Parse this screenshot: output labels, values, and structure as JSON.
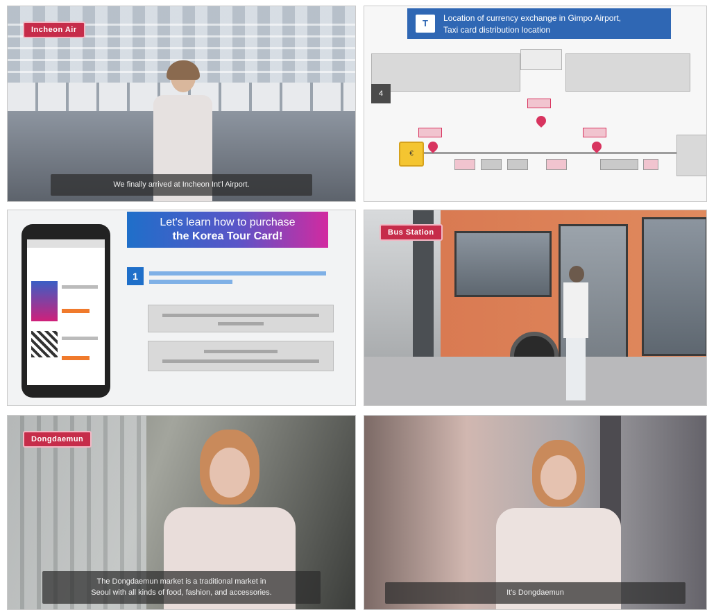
{
  "panels": {
    "p1": {
      "badge": "Incheon Air",
      "subtitle": "We finally arrived at Incheon Int'l Airport."
    },
    "p2": {
      "title_line1": "Location of currency exchange in Gimpo Airport,",
      "title_line2": "Taxi card distribution location",
      "icon": "T",
      "gate": "4",
      "kiosk": "€"
    },
    "p3": {
      "promo_line1": "Let's learn how to purchase",
      "promo_line2": "the Korea Tour Card!",
      "step": "1"
    },
    "p4": {
      "badge": "Bus Station"
    },
    "p5": {
      "badge": "Dongdaemun",
      "subtitle_line1": "The Dongdaemun market is a traditional market in",
      "subtitle_line2": "Seoul with all kinds of food, fashion, and accessories."
    },
    "p6": {
      "subtitle": "It's Dongdaemun"
    }
  },
  "colors": {
    "badge": "#c62c4a",
    "map_title": "#2f67b4",
    "promo_start": "#1f6fc9",
    "promo_end": "#d22aa0",
    "bus": "#d97a52"
  }
}
